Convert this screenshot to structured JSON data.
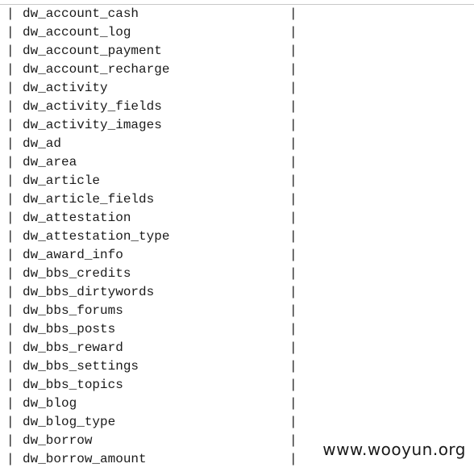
{
  "separator": "|",
  "tables": [
    "dw_account_cash",
    "dw_account_log",
    "dw_account_payment",
    "dw_account_recharge",
    "dw_activity",
    "dw_activity_fields",
    "dw_activity_images",
    "dw_ad",
    "dw_area",
    "dw_article",
    "dw_article_fields",
    "dw_attestation",
    "dw_attestation_type",
    "dw_award_info",
    "dw_bbs_credits",
    "dw_bbs_dirtywords",
    "dw_bbs_forums",
    "dw_bbs_posts",
    "dw_bbs_reward",
    "dw_bbs_settings",
    "dw_bbs_topics",
    "dw_blog",
    "dw_blog_type",
    "dw_borrow",
    "dw_borrow_amount"
  ],
  "watermark": "www.wooyun.org"
}
